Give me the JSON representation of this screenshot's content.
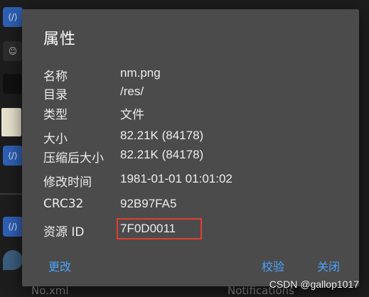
{
  "dialog": {
    "title": "属性",
    "rows": [
      {
        "label": "名称",
        "value": "nm.png"
      },
      {
        "label": "目录",
        "value": "/res/"
      },
      {
        "label": "类型",
        "value": "文件"
      },
      {
        "label": "大小",
        "value": "82.21K (84178)"
      },
      {
        "label": "压缩后大小",
        "value": "82.21K (84178)"
      },
      {
        "label": "修改时间",
        "value": "1981-01-01 01:01:02"
      },
      {
        "label": "CRC32",
        "value": "92B97FA5"
      },
      {
        "label": "资源 ID",
        "value": "7F0D0011"
      }
    ],
    "buttons": {
      "modify": "更改",
      "verify": "校验",
      "close": "关闭"
    },
    "accent_color": "#4aa3ff",
    "highlight_color": "#e23d33"
  },
  "background": {
    "bottom_left_text": "No.xml",
    "bottom_right_text": "Notifications"
  },
  "watermark": "CSDN @gallop1017"
}
